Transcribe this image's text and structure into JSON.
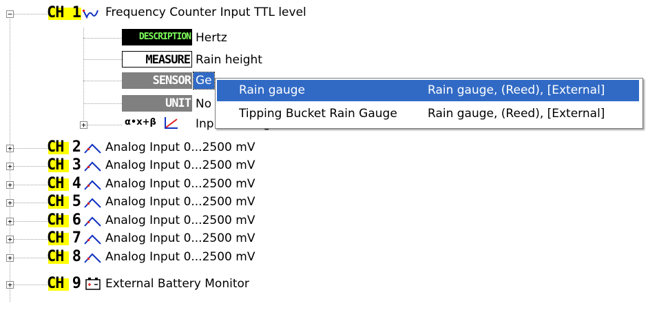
{
  "tree": {
    "ch1": {
      "tag": "CH 1",
      "title": "Frequency Counter Input TTL level",
      "children": [
        {
          "tag": "DESCRIPTION",
          "value": "Hertz"
        },
        {
          "tag": "MEASURE",
          "value": "Rain height"
        },
        {
          "tag": "SENSOR",
          "value": "Ge"
        },
        {
          "tag": "UNIT",
          "value": "No"
        }
      ],
      "coefficients_tag": "α•x+β",
      "coefficients_label": "Input scaling coefficients:"
    },
    "channels": [
      {
        "tag": "CH 2",
        "title": "Analog Input 0...2500 mV"
      },
      {
        "tag": "CH 3",
        "title": "Analog Input 0...2500 mV"
      },
      {
        "tag": "CH 4",
        "title": "Analog Input 0...2500 mV"
      },
      {
        "tag": "CH 5",
        "title": "Analog Input 0...2500 mV"
      },
      {
        "tag": "CH 6",
        "title": "Analog Input 0...2500 mV"
      },
      {
        "tag": "CH 7",
        "title": "Analog Input 0...2500 mV"
      },
      {
        "tag": "CH 8",
        "title": "Analog Input 0...2500 mV"
      },
      {
        "tag": "CH 9",
        "title": "External Battery Monitor"
      }
    ]
  },
  "context_menu": {
    "items": [
      {
        "name": "Rain gauge",
        "details": "Rain gauge, (Reed), [External]",
        "selected": true
      },
      {
        "name": "Tipping Bucket Rain Gauge",
        "details": "Rain gauge, (Reed), [External]",
        "selected": false
      }
    ]
  },
  "icons": {
    "ch1_icon": "frequency-wave-icon",
    "analog_icon": "analog-wave-icon",
    "battery_icon": "battery-icon",
    "scaling_icon": "scaling-graph-icon"
  },
  "colors": {
    "channel_highlight": "#ffff00",
    "selection": "#316ac5",
    "tag_dark": "#000000",
    "tag_grey": "#808080",
    "desc_green": "#2e7d1e"
  }
}
